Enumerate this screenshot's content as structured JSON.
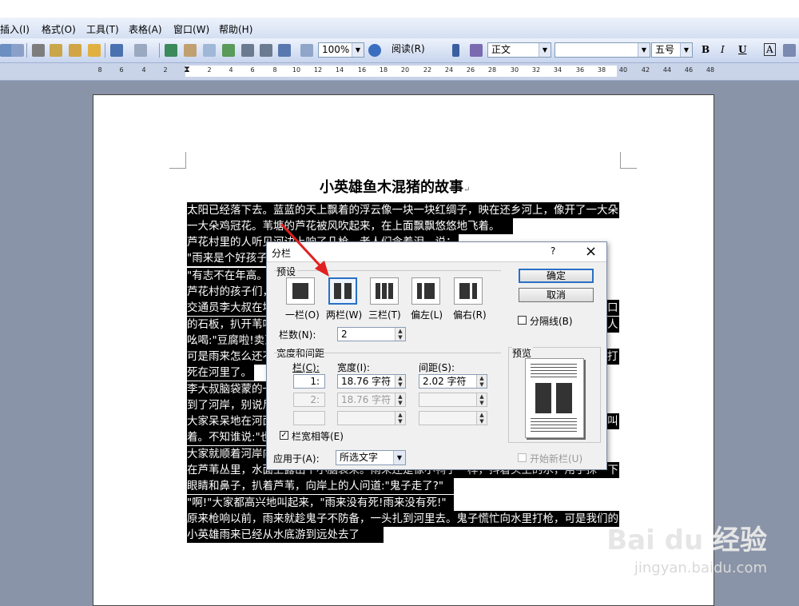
{
  "menu": [
    "插入(I)",
    "格式(O)",
    "工具(T)",
    "表格(A)",
    "窗口(W)",
    "帮助(H)"
  ],
  "toolbar": {
    "zoom": "100%",
    "read": "阅读(R)",
    "style": "正文",
    "font": "",
    "size": "五号",
    "bold": "B",
    "italic": "I",
    "underline": "U",
    "char_border": "A"
  },
  "ruler": [
    "8",
    "6",
    "4",
    "2",
    "2",
    "4",
    "6",
    "8",
    "10",
    "12",
    "14",
    "16",
    "18",
    "20",
    "22",
    "24",
    "26",
    "28",
    "30",
    "32",
    "34",
    "36",
    "38",
    "40",
    "42",
    "44",
    "46",
    "48"
  ],
  "document": {
    "title": "小英雄鱼木混猪的故事",
    "lines": [
      "太阳已经落下去。蓝蓝的天上飘着的浮云像一块一块红绸子，映在还乡河上，像开了一大朵",
      "一大朵鸡冠花。苇塘的芦花被风吹起来，在上面飘飘悠悠地飞着。",
      "芦花村里的人听见河边上响了几枪，老人们含着泪，说：",
      "\"雨来是个好孩子",
      "\"有志不在年高。",
      "芦花村的孩子们，",
      "交通员李大叔在地",
      "的石板，扒开苇叶",
      "吆喝:\"豆腐啦!卖豆",
      "可是雨来怎么还不",
      "死在河里了。",
      "李大叔脑袋蒙的一",
      "到了河岸，别说尸",
      "大家呆呆地在河面",
      "着。不知谁说:\"也",
      "大家就顺着河岸向",
      "在芦苇丛里，水面上露出个小脑袋来。雨来还是像小鸭子一样，抖着头上的水，用手抹一下",
      "眼睛和鼻子，扒着芦苇，向岸上的人问道:\"鬼子走了?\"",
      "\"啊!\"大家都高兴地叫起来，\"雨来没有死!雨来没有死!\"",
      "原来枪响以前，雨来就趁鬼子不防备，一头扎到河里去。鬼子慌忙向水里打枪，可是我们的",
      "小英雄雨来已经从水底游到远处去了"
    ],
    "right_edge_chars": [
      "口",
      "人",
      "打",
      "叫"
    ]
  },
  "dialog": {
    "title": "分栏",
    "help": "?",
    "close": "×",
    "presets_label": "预设",
    "presets": [
      "一栏(O)",
      "两栏(W)",
      "三栏(T)",
      "偏左(L)",
      "偏右(R)"
    ],
    "ok": "确定",
    "cancel": "取消",
    "divider_label": "分隔线(B)",
    "columns_label": "栏数(N):",
    "columns_value": "2",
    "width_spacing_label": "宽度和间距",
    "col_header": "栏(C):",
    "width_header": "宽度(I):",
    "spacing_header": "间距(S):",
    "rows": [
      {
        "col": "1:",
        "width": "18.76 字符",
        "spacing": "2.02 字符"
      },
      {
        "col": "2:",
        "width": "18.76 字符",
        "spacing": ""
      },
      {
        "col": "",
        "width": "",
        "spacing": ""
      }
    ],
    "equal_width_label": "栏宽相等(E)",
    "apply_label": "应用于(A):",
    "apply_value": "所选文字",
    "preview_label": "预览",
    "new_column_label": "开始新栏(U)"
  },
  "watermark": {
    "brand": "Bai du 经验",
    "url": "jingyan.baidu.com"
  }
}
